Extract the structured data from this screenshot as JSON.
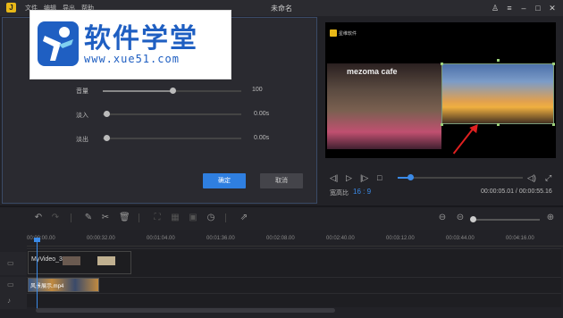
{
  "app": {
    "logo_letter": "J",
    "title": "未命名",
    "menus": [
      "文件",
      "编辑",
      "导出",
      "帮助"
    ]
  },
  "window_controls": {
    "user": "♙",
    "menu": "≡",
    "minimize": "–",
    "maximize": "□",
    "close": "✕"
  },
  "watermark": {
    "title": "软件学堂",
    "url": "www.xue51.com"
  },
  "settings": {
    "rows": [
      {
        "label": "音量",
        "value": "100",
        "level": 0.5
      },
      {
        "label": "淡入",
        "value": "0.00s",
        "level": 0
      },
      {
        "label": "淡出",
        "value": "0.00s",
        "level": 0
      }
    ],
    "confirm_label": "确定",
    "cancel_label": "取消"
  },
  "preview": {
    "logo_text": "星维软件",
    "sign_text": "mezoma cafe",
    "aspect_label": "宽高比",
    "aspect_value": "16 : 9",
    "time": "00:00:05.01 / 00:00:55.16",
    "progress": 0.1
  },
  "ruler": {
    "labels": [
      "00:00:00.00",
      "00:00:32.00",
      "00:01:04.00",
      "00:01:36.00",
      "00:02:08.00",
      "00:02:40.00",
      "00:03:12.00",
      "00:03:44.00",
      "00:04:16.00"
    ]
  },
  "tracks": {
    "video_clip_name": "MyVideo_3.mp4",
    "image_clip_name": "风景展示.mp4"
  },
  "colors": {
    "accent": "#2f7fe0",
    "progress": "#3b8be8",
    "annotation": "#e02020"
  }
}
